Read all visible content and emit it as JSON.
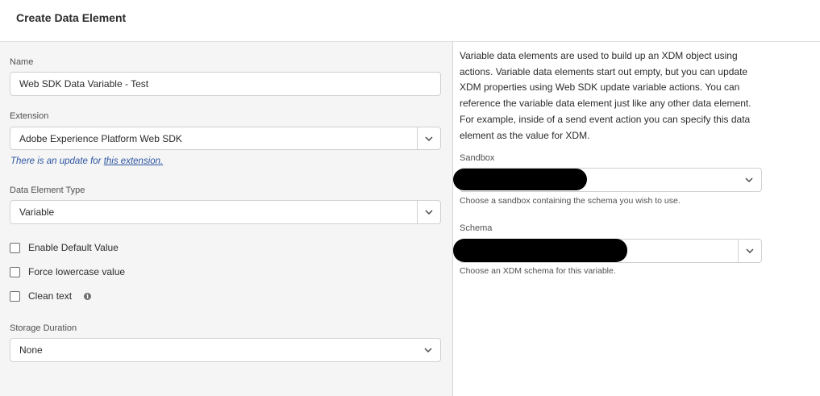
{
  "header": {
    "title": "Create Data Element"
  },
  "left": {
    "name_label": "Name",
    "name_value": "Web SDK Data Variable - Test",
    "extension_label": "Extension",
    "extension_value": "Adobe Experience Platform Web SDK",
    "update_text": "There is an update for ",
    "update_link": "this extension.",
    "type_label": "Data Element Type",
    "type_value": "Variable",
    "checkboxes": [
      {
        "label": "Enable Default Value",
        "checked": false
      },
      {
        "label": "Force lowercase value",
        "checked": false
      },
      {
        "label": "Clean text",
        "checked": false
      }
    ],
    "storage_label": "Storage Duration",
    "storage_value": "None"
  },
  "right": {
    "description": "Variable data elements are used to build up an XDM object using actions. Variable data elements start out empty, but you can update XDM properties using Web SDK update variable actions. You can reference the variable data element just like any other data element. For example, inside of a send event action you can specify this data element as the value for XDM.",
    "sandbox_label": "Sandbox",
    "sandbox_help": "Choose a sandbox containing the schema you wish to use.",
    "schema_label": "Schema",
    "schema_help": "Choose an XDM schema for this variable."
  },
  "icons": {
    "chevron": "chevron-down-icon",
    "info": "info-icon"
  },
  "colors": {
    "link": "#2d55a0",
    "panel_left": "#f5f5f5",
    "panel_right": "#ffffff",
    "redaction": "#000000"
  }
}
